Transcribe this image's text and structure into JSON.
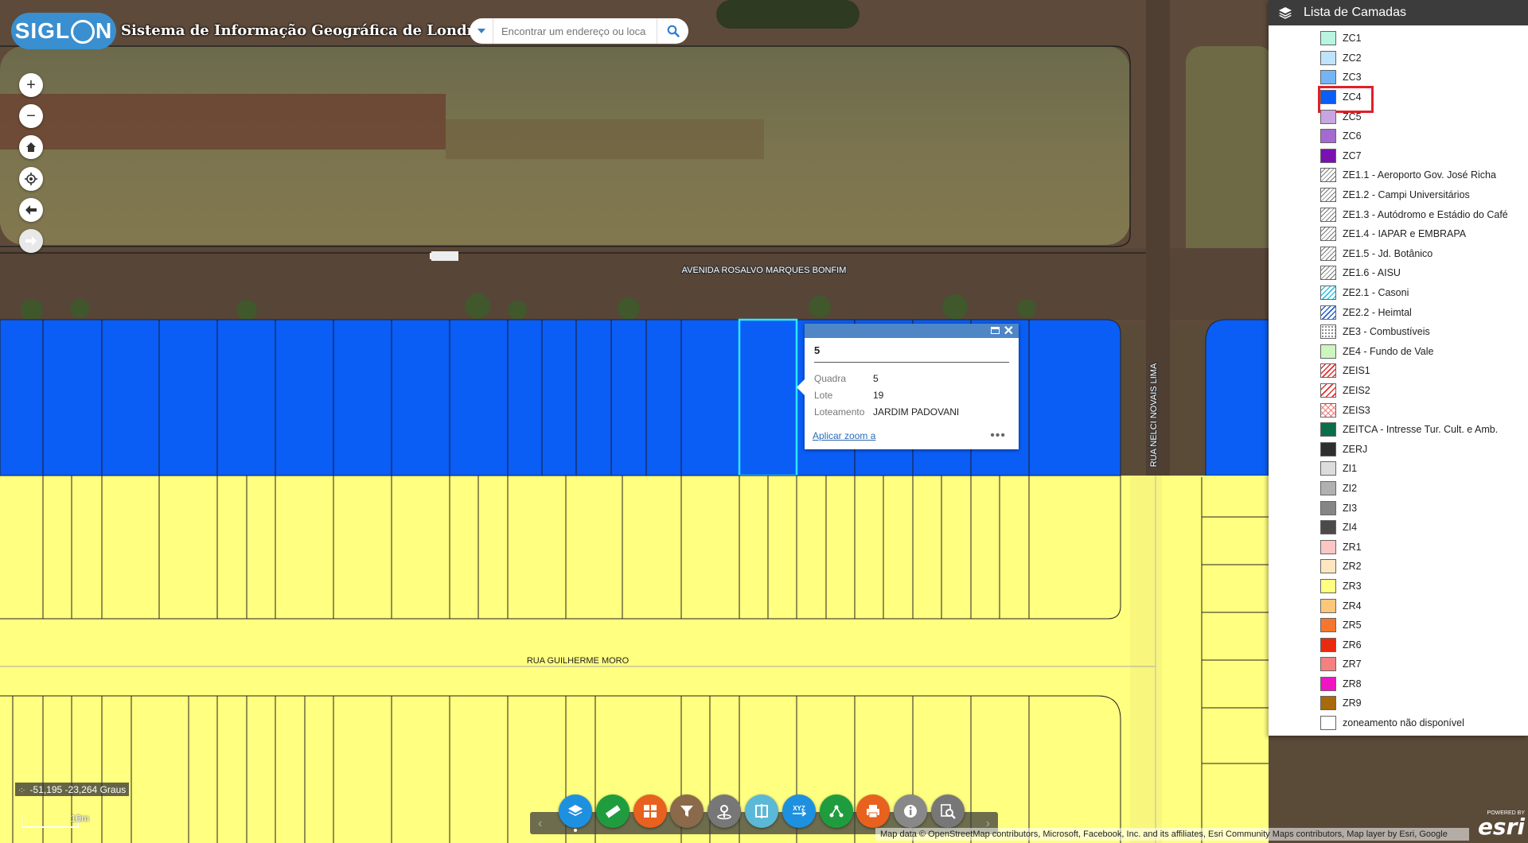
{
  "header": {
    "logo_text_a": "SIGL",
    "logo_text_b": "N",
    "title": "Sistema de Informação Geográfica de Londrina",
    "search_placeholder": "Encontrar um endereço ou loca"
  },
  "map": {
    "street_labels": {
      "avenida": "AVENIDA ROSALVO MARQUES BONFIM",
      "rua_guilherme": "RUA GUILHERME MORO",
      "rua_nelci": "RUA NELCI NOVAIS LIMA"
    },
    "colors": {
      "zc4": "#0a5df5",
      "zr3": "#ffff80",
      "selection": "#2ee6ff"
    }
  },
  "popup": {
    "title": "5",
    "rows": [
      {
        "key": "Quadra",
        "value": "5"
      },
      {
        "key": "Lote",
        "value": "19"
      },
      {
        "key": "Loteamento",
        "value": "JARDIM PADOVANI"
      }
    ],
    "zoom_link": "Aplicar zoom a",
    "more": "•••"
  },
  "layers": {
    "title": "Lista de Camadas",
    "items": [
      {
        "label": "ZC1",
        "color": "#b8f5e0"
      },
      {
        "label": "ZC2",
        "color": "#bfe3fb"
      },
      {
        "label": "ZC3",
        "color": "#74b4f5"
      },
      {
        "label": "ZC4",
        "color": "#0a5df5",
        "selected": true
      },
      {
        "label": "ZC5",
        "color": "#c8a4e0"
      },
      {
        "label": "ZC6",
        "color": "#a56ad0"
      },
      {
        "label": "ZC7",
        "color": "#7a10b0"
      },
      {
        "label": "ZE1.1 - Aeroporto Gov. José Richa",
        "pattern": "hatch"
      },
      {
        "label": "ZE1.2 - Campi Universitários",
        "pattern": "hatch"
      },
      {
        "label": "ZE1.3 - Autódromo e Estádio do Café",
        "pattern": "hatch"
      },
      {
        "label": "ZE1.4 - IAPAR e EMBRAPA",
        "pattern": "hatch"
      },
      {
        "label": "ZE1.5 - Jd. Botânico",
        "pattern": "hatch"
      },
      {
        "label": "ZE1.6 - AISU",
        "pattern": "hatch"
      },
      {
        "label": "ZE2.1 - Casoni",
        "pattern": "hatch-cyan"
      },
      {
        "label": "ZE2.2 - Heimtal",
        "pattern": "hatch-blue"
      },
      {
        "label": "ZE3 - Combustíveis",
        "pattern": "dots"
      },
      {
        "label": "ZE4 - Fundo de Vale",
        "color": "#ccf5c0"
      },
      {
        "label": "ZEIS1",
        "pattern": "hatch-red"
      },
      {
        "label": "ZEIS2",
        "pattern": "hatch-red2"
      },
      {
        "label": "ZEIS3",
        "pattern": "cross-red"
      },
      {
        "label": "ZEITCA - Intresse Tur. Cult. e Amb.",
        "color": "#0b6e48"
      },
      {
        "label": "ZERJ",
        "color": "#2e2e2e"
      },
      {
        "label": "ZI1",
        "color": "#dcdcdc"
      },
      {
        "label": "ZI2",
        "color": "#b0b0b0"
      },
      {
        "label": "ZI3",
        "color": "#858585"
      },
      {
        "label": "ZI4",
        "color": "#4a4a4a"
      },
      {
        "label": "ZR1",
        "color": "#fcc6c6"
      },
      {
        "label": "ZR2",
        "color": "#fde6c0"
      },
      {
        "label": "ZR3",
        "color": "#ffff80"
      },
      {
        "label": "ZR4",
        "color": "#fdc77a"
      },
      {
        "label": "ZR5",
        "color": "#f5762e"
      },
      {
        "label": "ZR6",
        "color": "#ea2a0e"
      },
      {
        "label": "ZR7",
        "color": "#f58080"
      },
      {
        "label": "ZR8",
        "color": "#f014c4"
      },
      {
        "label": "ZR9",
        "color": "#a86a0a"
      },
      {
        "label": "zoneamento não disponível",
        "color": "#ffffff"
      }
    ]
  },
  "status": {
    "coords": "-51,195 -23,264 Graus",
    "scale": "10m",
    "attribution": "Map data © OpenStreetMap contributors, Microsoft, Facebook, Inc. and its affiliates, Esri Community Maps contributors, Map layer by Esri, Google",
    "esri_powered": "POWERED BY",
    "esri_logo": "esri"
  },
  "toolbar": {
    "tools": [
      {
        "name": "layers",
        "color": "#1e90e0"
      },
      {
        "name": "measure",
        "color": "#1f9d3e"
      },
      {
        "name": "basemap",
        "color": "#e8611e"
      },
      {
        "name": "filter",
        "color": "#8a6a4a"
      },
      {
        "name": "geolocate",
        "color": "#777777"
      },
      {
        "name": "swipe",
        "color": "#5bb8d6"
      },
      {
        "name": "xyz-coordinates",
        "color": "#1e90e0"
      },
      {
        "name": "share",
        "color": "#1f9d3e"
      },
      {
        "name": "print",
        "color": "#e8611e"
      },
      {
        "name": "info",
        "color": "#888888"
      },
      {
        "name": "query",
        "color": "#777777"
      }
    ]
  }
}
